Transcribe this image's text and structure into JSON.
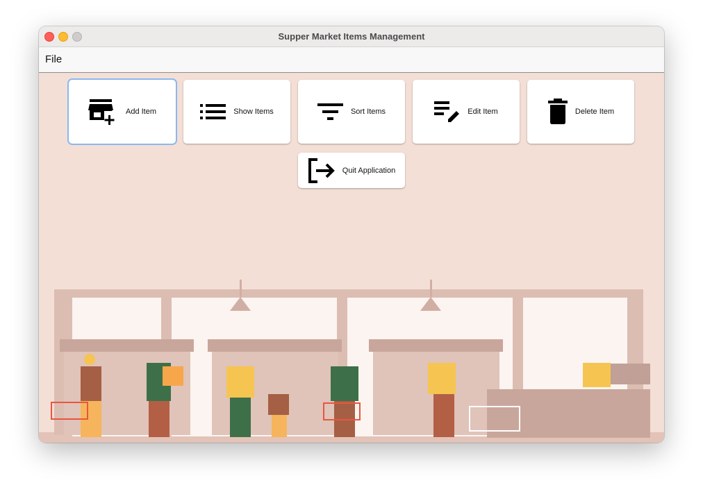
{
  "window": {
    "title": "Supper Market Items Management"
  },
  "menu": {
    "file": "File"
  },
  "buttons": {
    "add": {
      "label": "Add Item",
      "icon": "store-add-icon"
    },
    "show": {
      "label": "Show Items",
      "icon": "list-icon"
    },
    "sort": {
      "label": "Sort Items",
      "icon": "filter-icon"
    },
    "edit": {
      "label": "Edit Item",
      "icon": "edit-list-icon"
    },
    "delete": {
      "label": "Delete Item",
      "icon": "trash-icon"
    },
    "quit": {
      "label": "Quit Application",
      "icon": "logout-icon"
    }
  },
  "colors": {
    "background": "#f3dfd6",
    "focus": "#8bb8ef"
  }
}
